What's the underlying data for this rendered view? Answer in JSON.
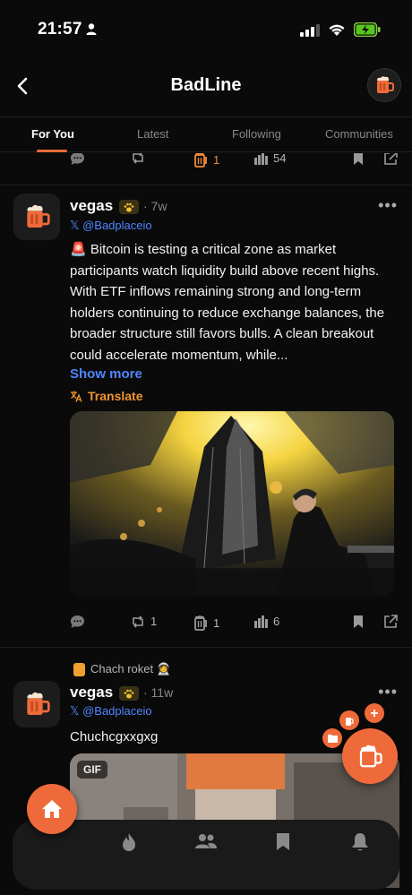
{
  "status_bar": {
    "time": "21:57"
  },
  "header": {
    "title": "BadLine"
  },
  "tabs": [
    {
      "label": "For You",
      "active": true
    },
    {
      "label": "Latest",
      "active": false
    },
    {
      "label": "Following",
      "active": false
    },
    {
      "label": "Communities",
      "active": false
    }
  ],
  "top_actions": {
    "cheers": "1",
    "views": "54"
  },
  "post1": {
    "author": "vegas",
    "time": "· 7w",
    "handle": "𝕏 @Badplaceio",
    "text": "🚨 Bitcoin is testing a critical zone as market participants watch liquidity build above recent highs. With ETF inflows remaining strong and long-term holders continuing to reduce exchange balances, the broader structure still favors bulls. A clean breakout could accelerate momentum, while...",
    "show_more": "Show more",
    "translate": "Translate",
    "reposts": "1",
    "cheers": "1",
    "views": "6"
  },
  "post2": {
    "repost_label": "Chach roket 🧑‍🚀",
    "author": "vegas",
    "time": "· 11w",
    "handle": "𝕏 @Badplaceio",
    "text": "Chuchcgxxgxg",
    "gif_tag": "GIF"
  },
  "colors": {
    "accent": "#ef6a3a",
    "link": "#4f86ff",
    "translate": "#f0952f",
    "background": "#0a0a0a"
  }
}
